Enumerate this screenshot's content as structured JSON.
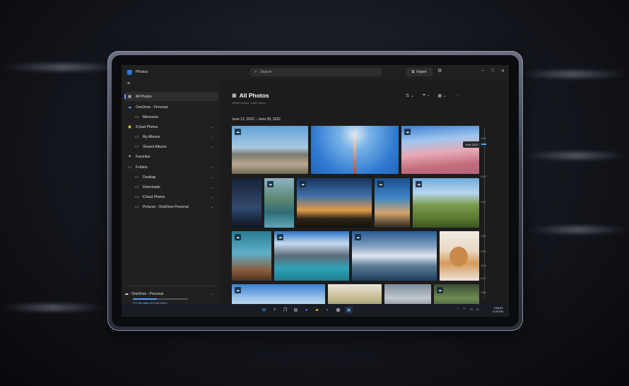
{
  "titlebar": {
    "app_title": "Photos",
    "search_placeholder": "Search",
    "import_label": "Import",
    "import_icon": "import-icon",
    "settings_icon": "gear-icon",
    "minimize": "–",
    "maximize": "□",
    "close": "✕"
  },
  "sidebar": {
    "menu_icon": "≡",
    "items": [
      {
        "label": "All Photos",
        "icon": "photos-icon",
        "active": true
      },
      {
        "label": "OneDrive - Personal",
        "icon": "cloud-icon"
      },
      {
        "label": "Memories",
        "icon": "folder-icon"
      },
      {
        "label": "iCloud Photos",
        "icon": "icloud-icon"
      },
      {
        "label": "My Albums",
        "icon": "folder-icon"
      },
      {
        "label": "Shared Albums",
        "icon": "folder-icon"
      },
      {
        "label": "Favorites",
        "icon": "heart-icon"
      },
      {
        "label": "Folders",
        "icon": "folder-icon"
      },
      {
        "label": "Desktop",
        "icon": "folder-icon"
      },
      {
        "label": "Downloads",
        "icon": "folder-icon"
      },
      {
        "label": "iCloud Photos",
        "icon": "folder-icon"
      },
      {
        "label": "Pictures - OneDrive Personal",
        "icon": "folder-icon"
      }
    ],
    "onedrive": {
      "title": "OneDrive - Personal",
      "usage": "2.2 GB used of 5 GB (44%)",
      "fraction": 0.44
    }
  },
  "main": {
    "title": "All Photos",
    "subtitle": "40638 photos, 1399 videos",
    "date_range": "June 12, 2022 – June 28, 2022",
    "toolbar": {
      "sort_icon": "sort-icon",
      "filter_icon": "filter-icon",
      "view_icon": "view-icon",
      "more": "···"
    }
  },
  "timeline": {
    "tooltip": "June 2022",
    "years": [
      "2023",
      "2022",
      "2021",
      "2020",
      "2019",
      "2018",
      "2017",
      "2016"
    ]
  },
  "taskbar": {
    "date": "10/6/21",
    "time": "9:28 PM"
  }
}
